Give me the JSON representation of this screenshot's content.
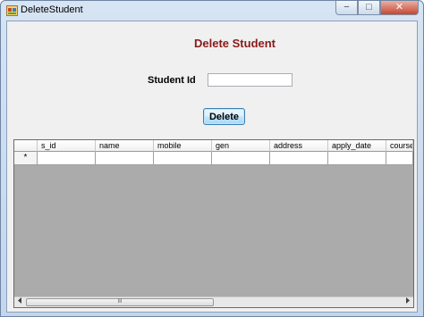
{
  "window": {
    "title": "DeleteStudent",
    "minimize_glyph": "−",
    "maximize_glyph": "□",
    "close_glyph": "✕"
  },
  "form": {
    "heading": "Delete Student",
    "student_id_label": "Student Id",
    "student_id_value": "",
    "delete_button": "Delete"
  },
  "grid": {
    "columns": [
      "s_id",
      "name",
      "mobile",
      "gen",
      "address",
      "apply_date",
      "course"
    ],
    "new_row_marker": "*",
    "scroll_thumb_grip": "III"
  },
  "colors": {
    "heading": "#8b1a1a",
    "grid_background": "#ababab",
    "form_background": "#f0f0f0"
  }
}
